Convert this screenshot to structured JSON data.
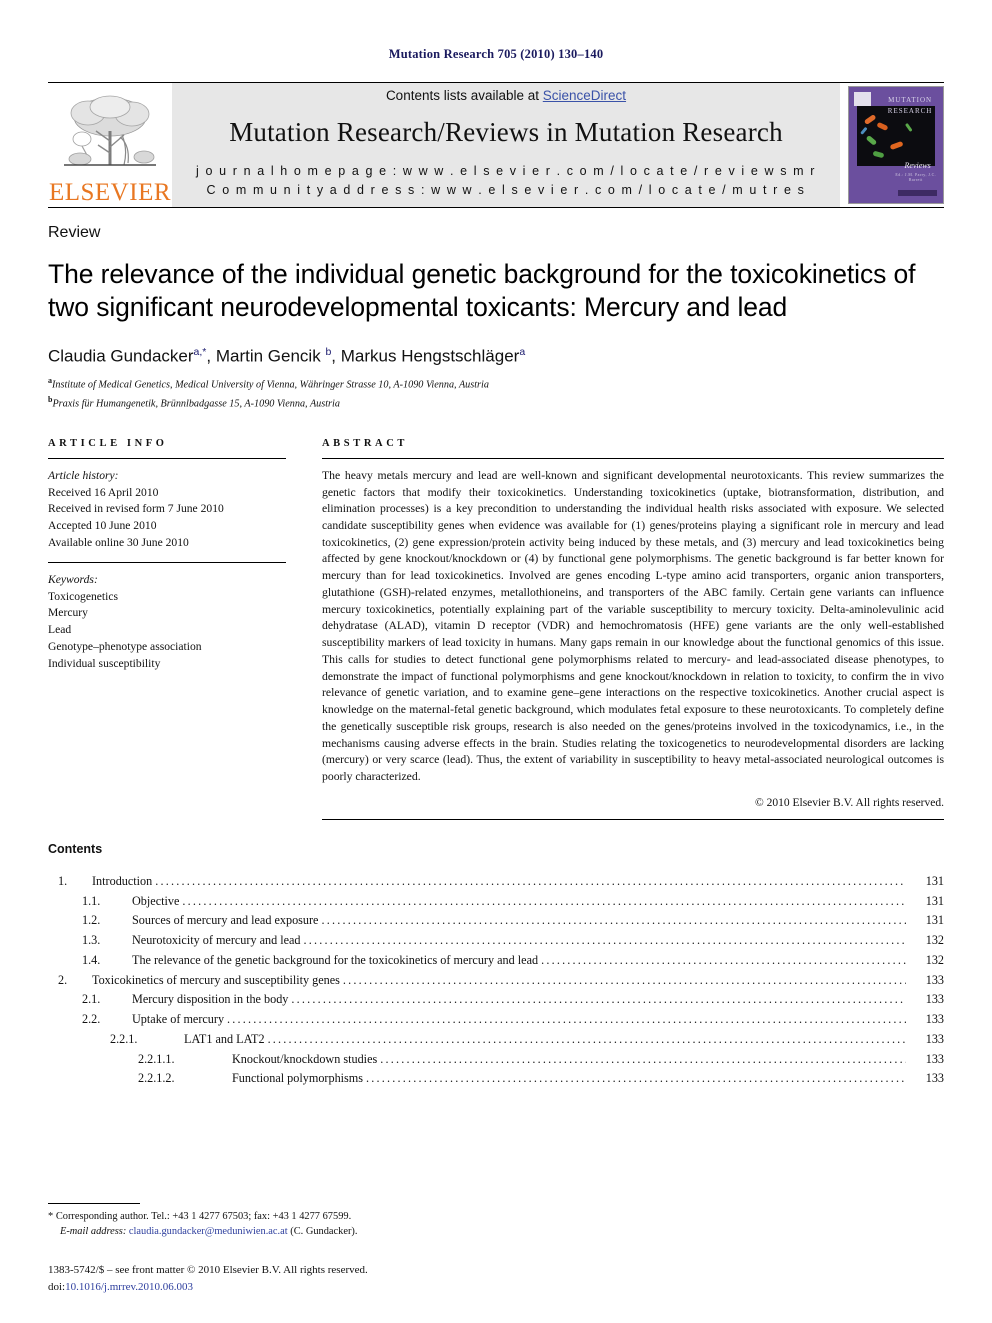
{
  "running_head": "Mutation Research 705 (2010) 130–140",
  "journal_header": {
    "contents_prefix": "Contents lists available at ",
    "sciencedirect": "ScienceDirect",
    "journal_title": "Mutation Research/Reviews in Mutation Research",
    "homepage": "j o u r n a l   h o m e p a g e :   w w w . e l s e v i e r . c o m / l o c a t e / r e v i e w s m r",
    "community": "C o m m u n i t y   a d d r e s s :   w w w . e l s e v i e r . c o m / l o c a t e / m u t r e s",
    "publisher": "ELSEVIER",
    "cover": {
      "title_line1": "MUTATION",
      "title_line2": "RESEARCH",
      "reviews_label": "Reviews",
      "subtitle": "Ed.: J.M. Parry, J.C. Barrett"
    },
    "sciencedirect_color": "#3a52a8",
    "elsevier_orange": "#E87722"
  },
  "article": {
    "type_label": "Review",
    "title": "The relevance of the individual genetic background for the toxicokinetics of two significant neurodevelopmental toxicants: Mercury and lead",
    "authors": [
      {
        "name": "Claudia Gundacker",
        "marks": "a,*"
      },
      {
        "name": "Martin Gencik",
        "marks": "b"
      },
      {
        "name": "Markus Hengstschläger",
        "marks": "a"
      }
    ],
    "affiliations": [
      {
        "mark": "a",
        "text": "Institute of Medical Genetics, Medical University of Vienna, Währinger Strasse 10, A-1090 Vienna, Austria"
      },
      {
        "mark": "b",
        "text": "Praxis für Humangenetik, Brünnlbadgasse 15, A-1090 Vienna, Austria"
      }
    ]
  },
  "article_info": {
    "heading": "ARTICLE INFO",
    "history_label": "Article history:",
    "history": [
      "Received 16 April 2010",
      "Received in revised form 7 June 2010",
      "Accepted 10 June 2010",
      "Available online 30 June 2010"
    ],
    "keywords_label": "Keywords:",
    "keywords": [
      "Toxicogenetics",
      "Mercury",
      "Lead",
      "Genotype–phenotype association",
      "Individual susceptibility"
    ]
  },
  "abstract": {
    "heading": "ABSTRACT",
    "text": "The heavy metals mercury and lead are well-known and significant developmental neurotoxicants. This review summarizes the genetic factors that modify their toxicokinetics. Understanding toxicokinetics (uptake, biotransformation, distribution, and elimination processes) is a key precondition to understanding the individual health risks associated with exposure. We selected candidate susceptibility genes when evidence was available for (1) genes/proteins playing a significant role in mercury and lead toxicokinetics, (2) gene expression/protein activity being induced by these metals, and (3) mercury and lead toxicokinetics being affected by gene knockout/knockdown or (4) by functional gene polymorphisms. The genetic background is far better known for mercury than for lead toxicokinetics. Involved are genes encoding L-type amino acid transporters, organic anion transporters, glutathione (GSH)-related enzymes, metallothioneins, and transporters of the ABC family. Certain gene variants can influence mercury toxicokinetics, potentially explaining part of the variable susceptibility to mercury toxicity. Delta-aminolevulinic acid dehydratase (ALAD), vitamin D receptor (VDR) and hemochromatosis (HFE) gene variants are the only well-established susceptibility markers of lead toxicity in humans. Many gaps remain in our knowledge about the functional genomics of this issue. This calls for studies to detect functional gene polymorphisms related to mercury- and lead-associated disease phenotypes, to demonstrate the impact of functional polymorphisms and gene knockout/knockdown in relation to toxicity, to confirm the in vivo relevance of genetic variation, and to examine gene–gene interactions on the respective toxicokinetics. Another crucial aspect is knowledge on the maternal-fetal genetic background, which modulates fetal exposure to these neurotoxicants. To completely define the genetically susceptible risk groups, research is also needed on the genes/proteins involved in the toxicodynamics, i.e., in the mechanisms causing adverse effects in the brain. Studies relating the toxicogenetics to neurodevelopmental disorders are lacking (mercury) or very scarce (lead). Thus, the extent of variability in susceptibility to heavy metal-associated neurological outcomes is poorly characterized.",
    "copyright": "© 2010 Elsevier B.V. All rights reserved."
  },
  "contents": {
    "heading": "Contents",
    "entries": [
      {
        "level": 1,
        "number": "1.",
        "label": "Introduction",
        "page": "131"
      },
      {
        "level": 2,
        "number": "1.1.",
        "label": "Objective",
        "page": "131"
      },
      {
        "level": 2,
        "number": "1.2.",
        "label": "Sources of mercury and lead exposure",
        "page": "131"
      },
      {
        "level": 2,
        "number": "1.3.",
        "label": "Neurotoxicity of mercury and lead",
        "page": "132"
      },
      {
        "level": 2,
        "number": "1.4.",
        "label": "The relevance of the genetic background for the toxicokinetics of mercury and lead",
        "page": "132"
      },
      {
        "level": 1,
        "number": "2.",
        "label": "Toxicokinetics of mercury and susceptibility genes",
        "page": "133"
      },
      {
        "level": 2,
        "number": "2.1.",
        "label": "Mercury disposition in the body",
        "page": "133"
      },
      {
        "level": 2,
        "number": "2.2.",
        "label": "Uptake of mercury",
        "page": "133"
      },
      {
        "level": 3,
        "number": "2.2.1.",
        "label": "LAT1 and LAT2",
        "page": "133"
      },
      {
        "level": 4,
        "number": "2.2.1.1.",
        "label": "Knockout/knockdown studies",
        "page": "133"
      },
      {
        "level": 4,
        "number": "2.2.1.2.",
        "label": "Functional polymorphisms",
        "page": "133"
      }
    ]
  },
  "footer": {
    "corresponding_marker": "*",
    "corresponding": "Corresponding author. Tel.: +43 1 4277 67503; fax: +43 1 4277 67599.",
    "email_label": "E-mail address:",
    "email": "claudia.gundacker@meduniwien.ac.at",
    "email_person": "(C. Gundacker).",
    "imprint": "1383-5742/$ – see front matter © 2010 Elsevier B.V. All rights reserved.",
    "doi_label": "doi:",
    "doi": "10.1016/j.mrrev.2010.06.003"
  }
}
